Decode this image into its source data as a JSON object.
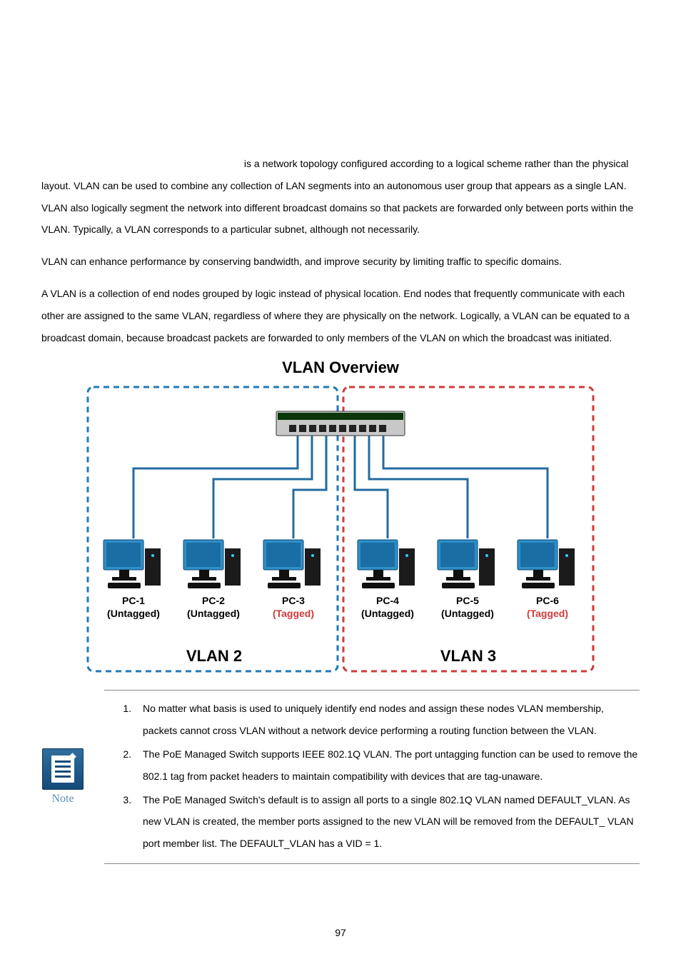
{
  "body": {
    "p1": " is a network topology configured according to a logical scheme rather than the physical layout. VLAN can be used to combine any collection of LAN segments into an autonomous user group that appears as a single LAN. VLAN also logically segment the network into different broadcast domains so that packets are forwarded only between ports within the VLAN. Typically, a VLAN corresponds to a particular subnet, although not necessarily.",
    "p2": "VLAN can enhance performance by conserving bandwidth, and improve security by limiting traffic to specific domains.",
    "p3": "A VLAN is a collection of end nodes grouped by logic instead of physical location. End nodes that frequently communicate with each other are assigned to the same VLAN, regardless of where they are physically on the network. Logically, a VLAN can be equated to a broadcast domain, because broadcast packets are forwarded to only members of the VLAN on which the broadcast was initiated."
  },
  "diagram": {
    "title": "VLAN Overview",
    "vlan_left_label": "VLAN 2",
    "vlan_right_label": "VLAN 3",
    "colors": {
      "vlan2_dash": "#1f7ab8",
      "vlan3_dash": "#d13a3a",
      "monitor": "#2f8fc8",
      "monitor_dark": "#1a6ea3",
      "case": "#1b1b1b",
      "switch_body": "#c8c8c8",
      "cable": "#236b9f"
    },
    "nodes": [
      {
        "id": "PC-1",
        "tag": "(Untagged)",
        "tag_color": "#000"
      },
      {
        "id": "PC-2",
        "tag": "(Untagged)",
        "tag_color": "#000"
      },
      {
        "id": "PC-3",
        "tag": "(Tagged)",
        "tag_color": "#d13a3a"
      },
      {
        "id": "PC-4",
        "tag": "(Untagged)",
        "tag_color": "#000"
      },
      {
        "id": "PC-5",
        "tag": "(Untagged)",
        "tag_color": "#000"
      },
      {
        "id": "PC-6",
        "tag": "(Tagged)",
        "tag_color": "#d13a3a"
      }
    ]
  },
  "note": {
    "icon_caption": "Note",
    "items": [
      "No matter what basis is used to uniquely identify end nodes and assign these nodes VLAN membership, packets cannot cross VLAN without a network device performing a routing function between the VLAN.",
      "The PoE Managed Switch supports IEEE 802.1Q VLAN. The port untagging function can be used to remove the 802.1 tag from packet headers to maintain compatibility with devices that are tag-unaware.",
      "The PoE Managed Switch's default is to assign all ports to a single 802.1Q VLAN named DEFAULT_VLAN. As new VLAN is created, the member ports assigned to the new VLAN will be removed from the DEFAULT_ VLAN port member list. The DEFAULT_VLAN has a VID = 1."
    ]
  },
  "page_number": "97"
}
